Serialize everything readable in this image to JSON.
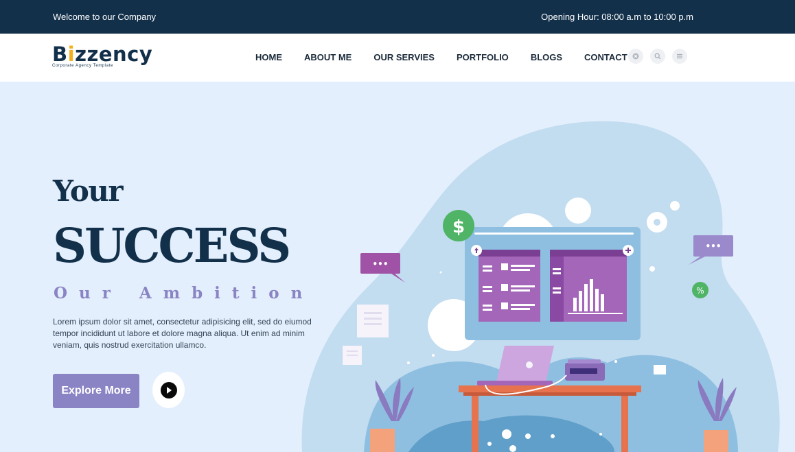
{
  "topbar": {
    "welcome": "Welcome to our Company",
    "hours": "Opening Hour: 08:00 a.m to 10:00 p.m"
  },
  "logo": {
    "name_pre": "B",
    "name_dot": "i",
    "name_post": "zzency",
    "tagline": "Corporate Agency Template"
  },
  "nav": {
    "items": [
      "HOME",
      "ABOUT ME",
      "OUR SERVIES",
      "PORTFOLIO",
      "BLOGS",
      "CONTACT"
    ],
    "icons": [
      "circle-close-icon",
      "search-icon",
      "menu-icon"
    ]
  },
  "hero": {
    "line1": "Your",
    "line2": "SUCCESS",
    "line3": "Our Ambition",
    "description": "Lorem ipsum dolor sit amet, consectetur adipisicing elit, sed do eiumod tempor incididunt ut labore et dolore magna aliqua. Ut enim ad minim veniam, quis nostrud exercitation ullamco.",
    "button": "Explore More"
  },
  "illustration": {
    "dollar": "$",
    "percent": "%",
    "dots": "•••"
  },
  "colors": {
    "navy": "#13304a",
    "accent": "#8a84c4",
    "gold": "#f2b01e",
    "hero_bg": "#e3effc"
  }
}
